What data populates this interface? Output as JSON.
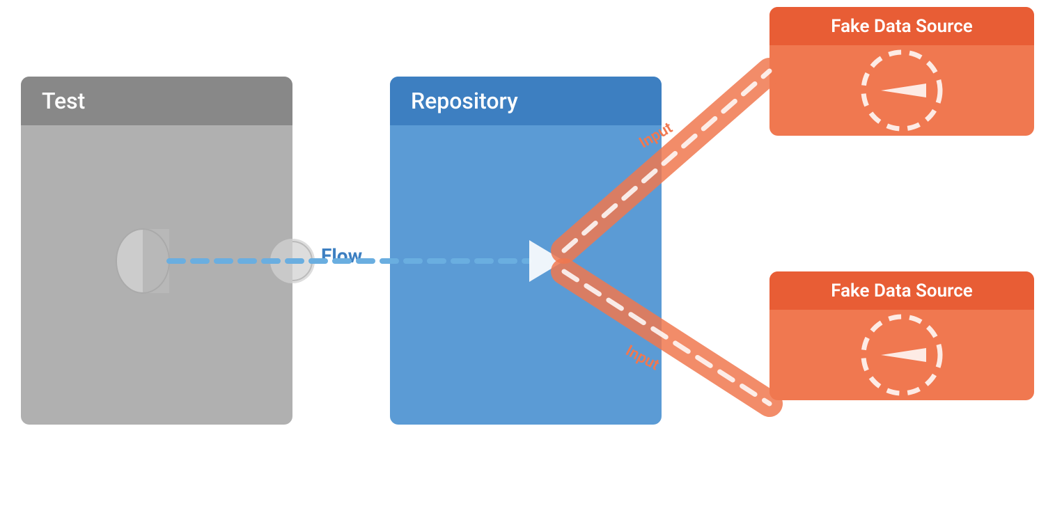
{
  "test_block": {
    "header_label": "Test"
  },
  "repo_block": {
    "header_label": "Repository"
  },
  "fake_ds_1": {
    "header_label": "Fake Data Source",
    "input_label": "Input"
  },
  "fake_ds_2": {
    "header_label": "Fake Data Source",
    "input_label": "Input"
  },
  "flow_label": "Flow",
  "colors": {
    "test_header_bg": "#888888",
    "test_body_bg": "#b0b0b0",
    "repo_header_bg": "#3d7fc1",
    "repo_body_bg": "#5b9bd5",
    "fake_ds_header_bg": "#e85d35",
    "fake_ds_body_bg": "#f07850",
    "flow_label_color": "#3d7fc1",
    "input_label_color": "#f07850",
    "dashed_line_blue": "#6aaee0",
    "dashed_line_orange": "#f4a07a",
    "arrow_white": "#ffffff"
  }
}
